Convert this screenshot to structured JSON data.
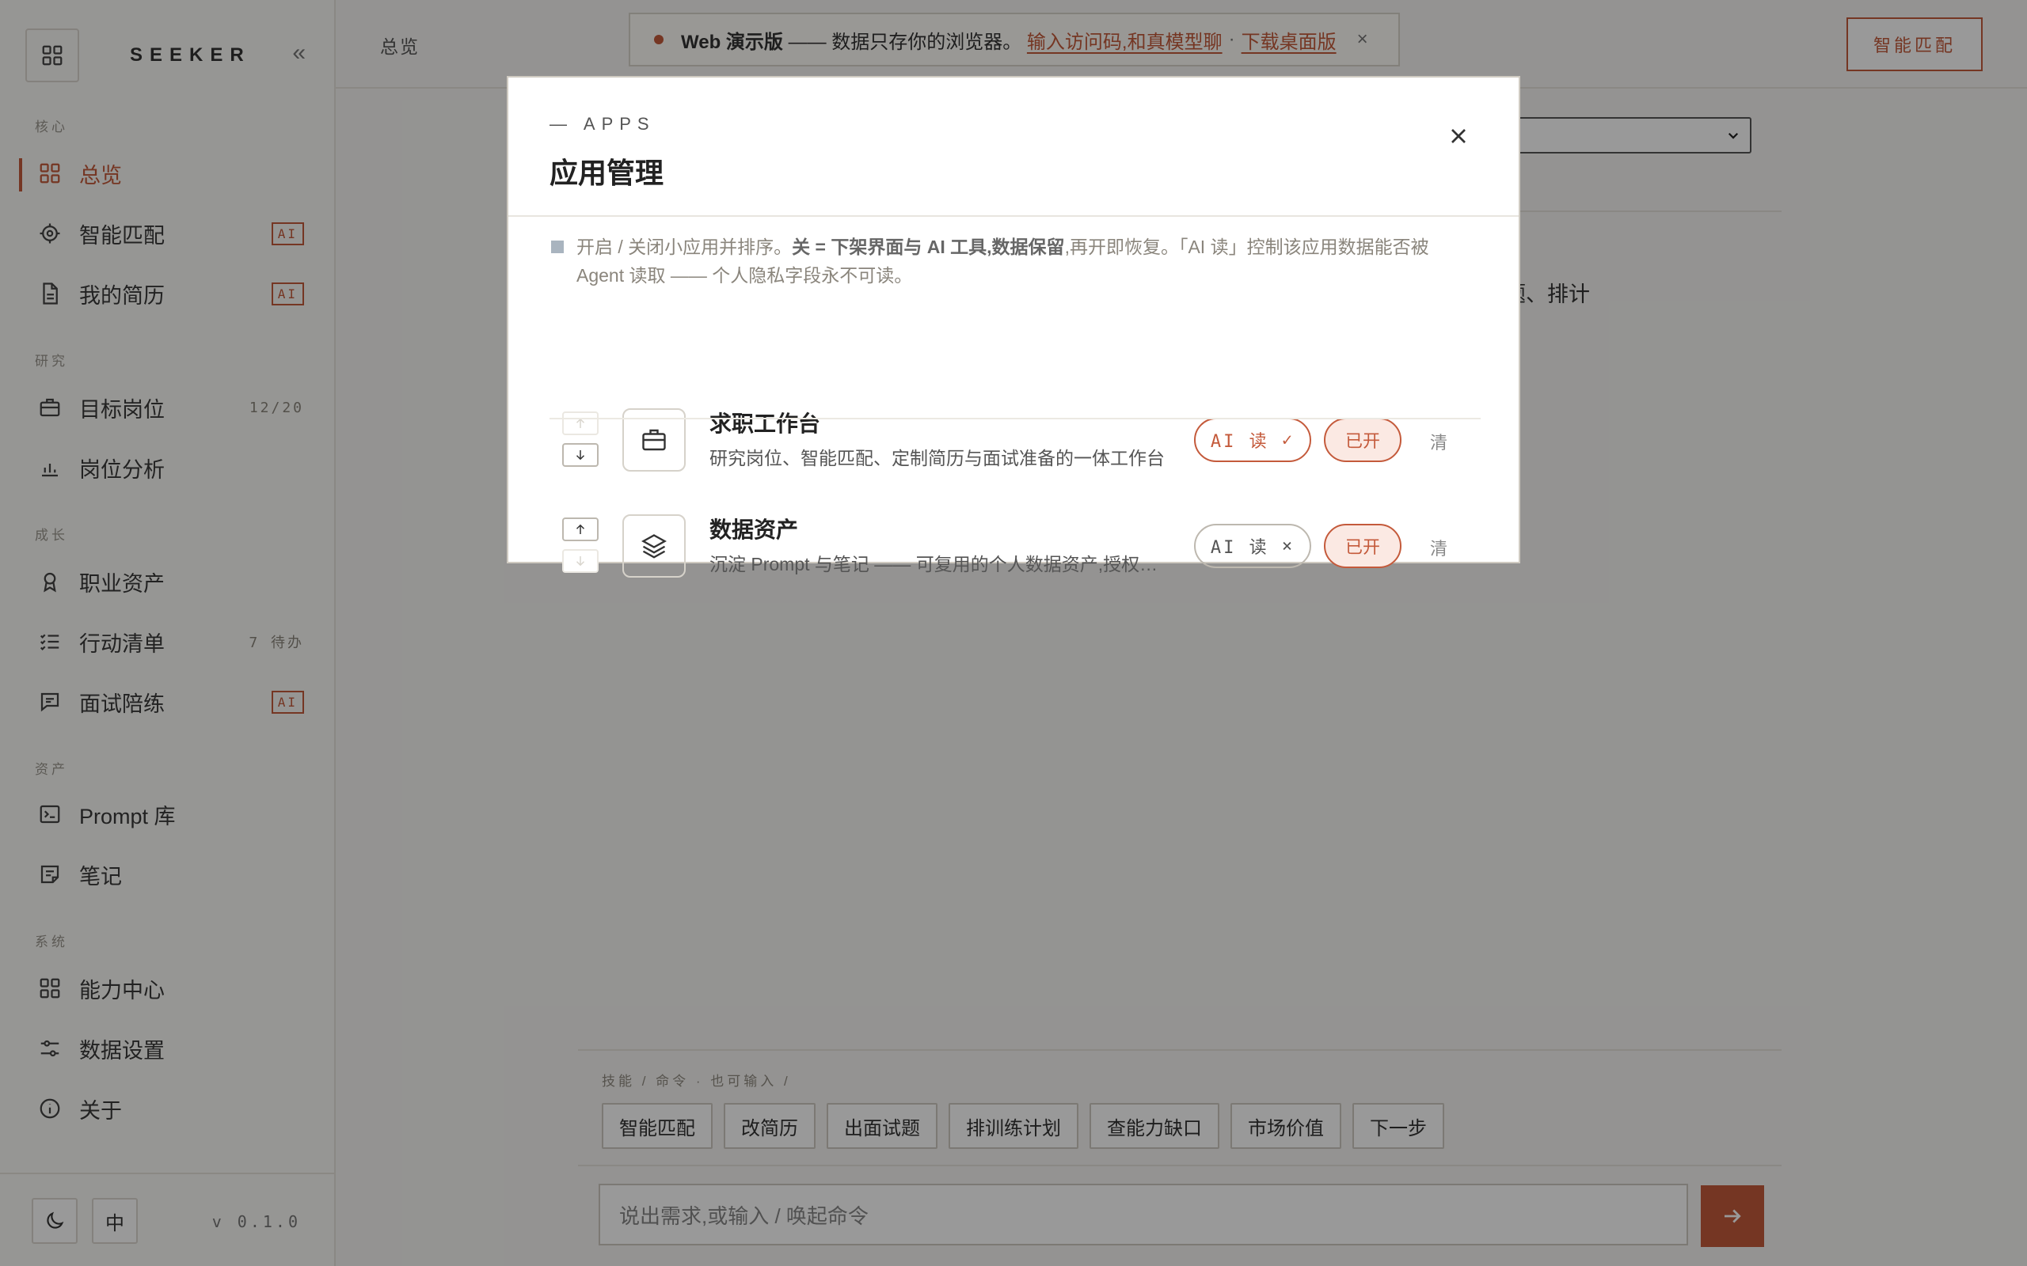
{
  "app": {
    "brand": "SEEKER",
    "version": "v 0.1.0"
  },
  "sidebar": {
    "sections": [
      {
        "title": "核心"
      },
      {
        "title": "研究"
      },
      {
        "title": "成长"
      },
      {
        "title": "资产"
      },
      {
        "title": "系统"
      }
    ],
    "items": [
      {
        "label": "总览",
        "icon": "grid-icon",
        "active": true
      },
      {
        "label": "智能匹配",
        "icon": "target-icon",
        "badge": "AI"
      },
      {
        "label": "我的简历",
        "icon": "document-icon",
        "badge": "AI"
      },
      {
        "label": "目标岗位",
        "icon": "briefcase-icon",
        "count": "12/20"
      },
      {
        "label": "岗位分析",
        "icon": "bar-chart-icon"
      },
      {
        "label": "职业资产",
        "icon": "award-icon"
      },
      {
        "label": "行动清单",
        "icon": "checklist-icon",
        "count": "7 待办"
      },
      {
        "label": "面试陪练",
        "icon": "chat-icon",
        "badge": "AI"
      },
      {
        "label": "Prompt 库",
        "icon": "terminal-icon"
      },
      {
        "label": "笔记",
        "icon": "note-icon"
      },
      {
        "label": "能力中心",
        "icon": "grid-icon"
      },
      {
        "label": "数据设置",
        "icon": "sliders-icon"
      },
      {
        "label": "关于",
        "icon": "info-icon"
      }
    ],
    "footer": {
      "theme_icon": "moon-icon",
      "lang_label": "中"
    }
  },
  "header": {
    "breadcrumb": "总览",
    "match_button": "智能匹配",
    "banner": {
      "prefix": "Web 演示版",
      "text": " —— 数据只存你的浏览器。 ",
      "link1": "输入访问码,和真模型聊",
      "sep": "·",
      "link2": "下载桌面版",
      "close": "×"
    }
  },
  "main": {
    "select_value": "",
    "bg_text": "题、排计"
  },
  "composer": {
    "hint": "技能 / 命令 · 也可输入 /",
    "chips": [
      "智能匹配",
      "改简历",
      "出面试题",
      "排训练计划",
      "查能力缺口",
      "市场价值",
      "下一步"
    ],
    "placeholder": "说出需求,或输入 / 唤起命令"
  },
  "modal": {
    "eyebrow": "— APPS",
    "title": "应用管理",
    "note_normal1": "开启 / 关闭小应用并排序。",
    "note_bold": "关 = 下架界面与 AI 工具,数据保留",
    "note_normal2": ",再开即恢复。「AI 读」控制该应用数据能否被 Agent 读取 —— 个人隐私字段永不可读。",
    "apps": [
      {
        "name": "求职工作台",
        "desc": "研究岗位、智能匹配、定制简历与面试准备的一体工作台",
        "icon": "briefcase-icon",
        "ai_label": "AI 读",
        "ai_state": "✓",
        "ai_enabled": true,
        "status": "已开",
        "clear": "清"
      },
      {
        "name": "数据资产",
        "desc": "沉淀 Prompt 与笔记 —— 可复用的个人数据资产,授权后可被 AI 读取",
        "icon": "layers-icon",
        "ai_label": "AI 读",
        "ai_state": "×",
        "ai_enabled": false,
        "status": "已开",
        "clear": "清"
      }
    ]
  },
  "colors": {
    "accent": "#c45a3b",
    "background": "#f7f6f3",
    "overlay": "rgba(0,0,0,0.40)"
  }
}
